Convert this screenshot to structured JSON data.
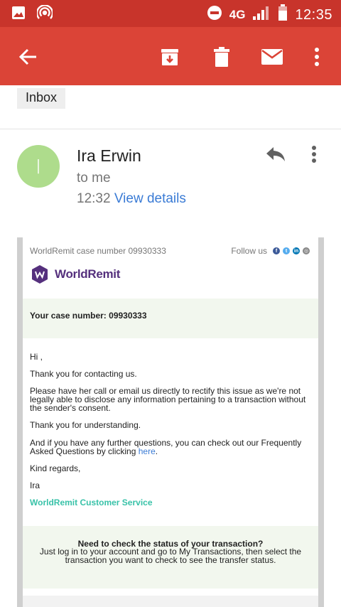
{
  "status_bar": {
    "time": "12:35",
    "network": "4G",
    "icons": [
      "image-icon",
      "hotspot-icon",
      "do-not-disturb-icon",
      "signal-icon",
      "battery-icon"
    ]
  },
  "app_bar": {
    "icons": [
      "back-arrow-icon",
      "archive-icon",
      "delete-icon",
      "mark-unread-icon",
      "more-vert-icon"
    ],
    "color": "#db4437"
  },
  "label": "Inbox",
  "message": {
    "avatar_letter": "I",
    "avatar_color": "#aedc8c",
    "sender": "Ira Erwin",
    "recipient": "to me",
    "time": "12:32",
    "view_details": "View details"
  },
  "email": {
    "case_number_line": "WorldRemit case number 09930333",
    "follow_us": "Follow us",
    "social": [
      "facebook-icon",
      "twitter-icon",
      "linkedin-icon",
      "instagram-icon"
    ],
    "logo_text": "WorldRemit",
    "case_banner": "Your case number: 09930333",
    "greeting": "Hi ,",
    "p1": "Thank you for contacting us.",
    "p2": "Please have her call or email us directly to rectify this issue as we're not legally able to disclose any information pertaining to a transaction without the sender's consent.",
    "p3": "Thank you for understanding.",
    "p4_prefix": "And if you have any further questions, you can check out our Frequently Asked Questions by clicking ",
    "p4_link": "here",
    "p4_suffix": ".",
    "closing": "Kind regards,",
    "name": "Ira",
    "signature": "WorldRemit Customer Service",
    "help_question": "Need to check the status of your transaction?",
    "help_text": "Just log in to your account and go to My Transactions, then select the transaction you want to check to see the transfer status."
  }
}
